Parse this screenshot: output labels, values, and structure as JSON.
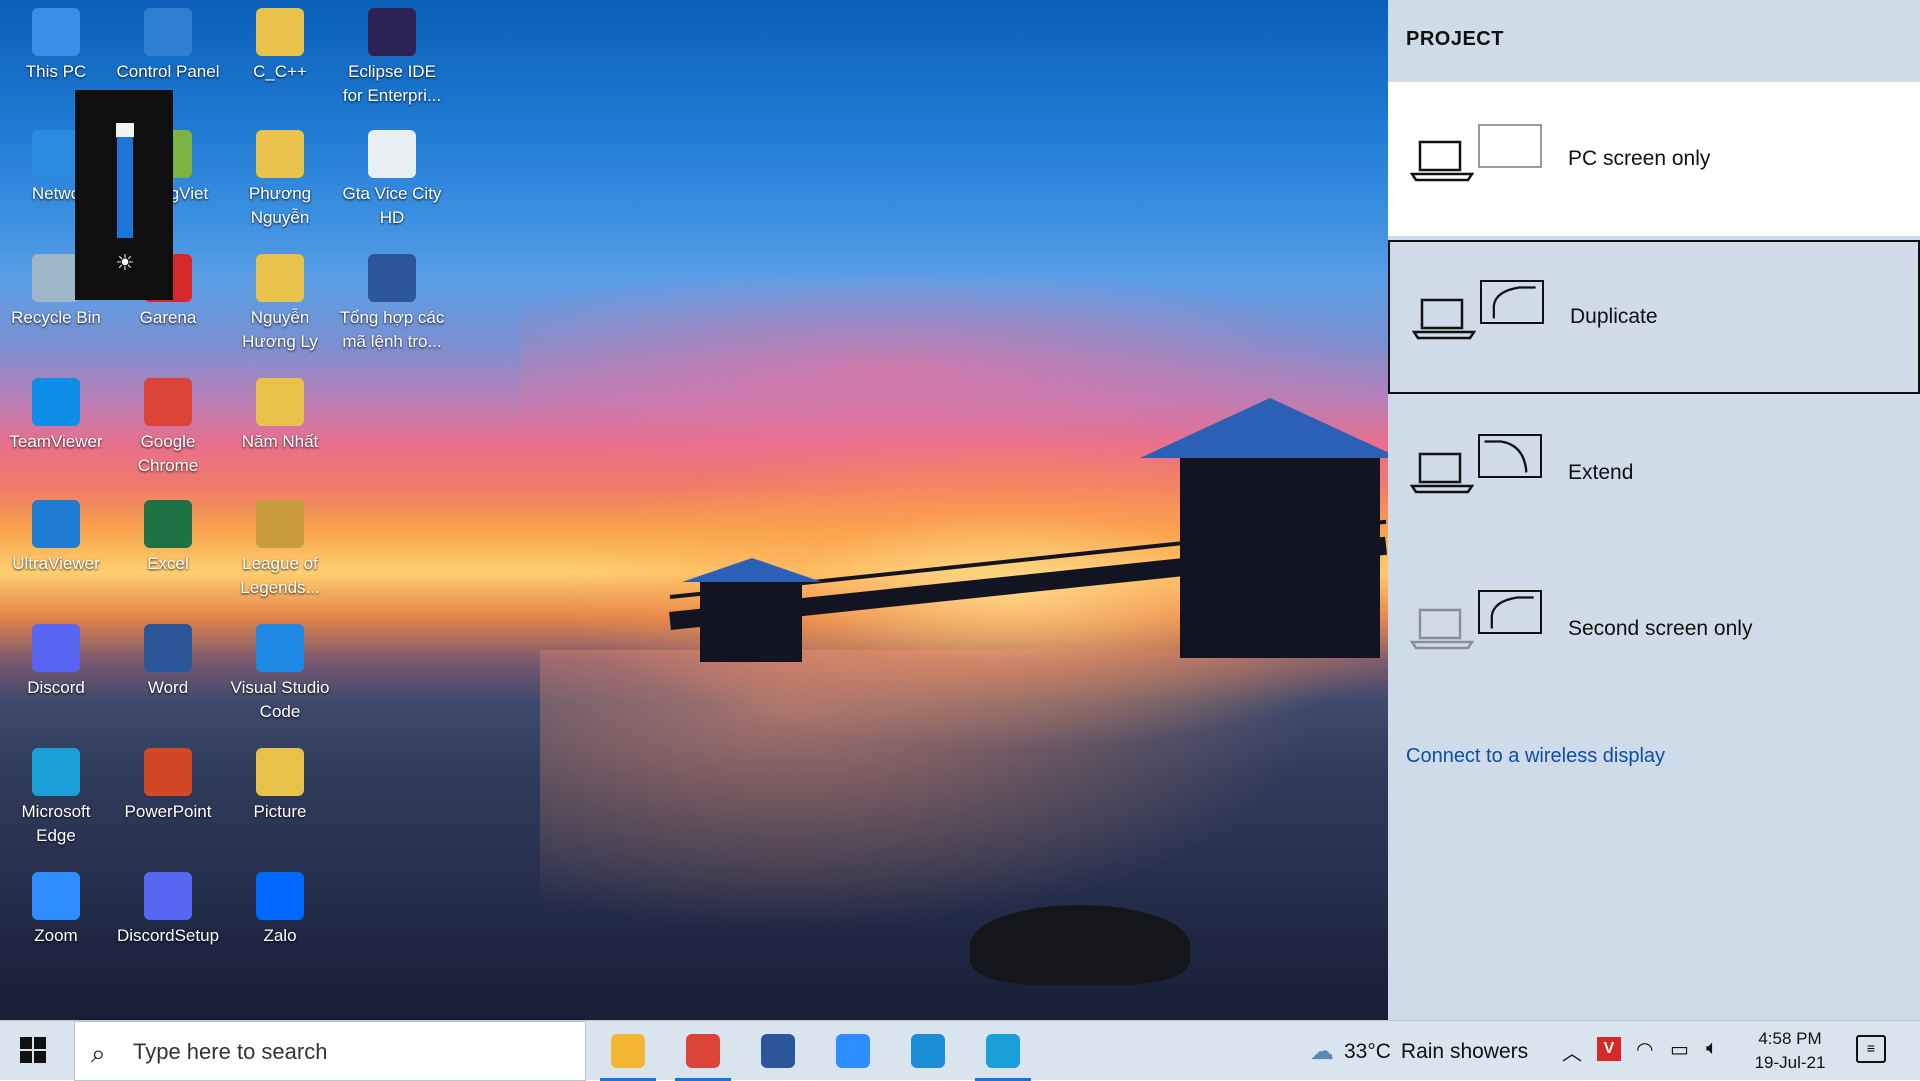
{
  "desktop": {
    "icons": [
      {
        "label": "This PC",
        "icon": "this-pc-icon",
        "color": "#3a8ee6"
      },
      {
        "label": "Control Panel",
        "icon": "control-panel-icon",
        "color": "#2f7fd0"
      },
      {
        "label": "C_C++",
        "icon": "folder-icon",
        "color": "#e8c24a"
      },
      {
        "label": "Eclipse IDE for Enterpri...",
        "icon": "eclipse-icon",
        "color": "#2c2255"
      },
      {
        "label": "Netwo",
        "icon": "network-icon",
        "color": "#2a8be0"
      },
      {
        "label": "oTiengViet",
        "icon": "unikey-icon",
        "color": "#7cb342"
      },
      {
        "label": "Phương Nguyễn",
        "icon": "user-folder-icon",
        "color": "#e8c24a"
      },
      {
        "label": "Gta Vice City HD",
        "icon": "file-icon",
        "color": "#e9eef3"
      },
      {
        "label": "Recycle Bin",
        "icon": "recycle-bin-icon",
        "color": "#9fb6c8"
      },
      {
        "label": "Garena",
        "icon": "garena-icon",
        "color": "#d62828"
      },
      {
        "label": "Nguyễn Hương Ly",
        "icon": "folder-icon",
        "color": "#e8c24a"
      },
      {
        "label": "Tổng hợp các mã lệnh tro...",
        "icon": "word-doc-icon",
        "color": "#2b579a"
      },
      {
        "label": "TeamViewer",
        "icon": "teamviewer-icon",
        "color": "#0e8ee9"
      },
      {
        "label": "Google Chrome",
        "icon": "chrome-icon",
        "color": "#db4437"
      },
      {
        "label": "Năm Nhất",
        "icon": "folder-icon",
        "color": "#e8c24a"
      },
      {
        "label": "UltraViewer",
        "icon": "ultraviewer-icon",
        "color": "#1f7ad1"
      },
      {
        "label": "Excel",
        "icon": "excel-icon",
        "color": "#1f7244"
      },
      {
        "label": "League of Legends...",
        "icon": "league-icon",
        "color": "#c89b3c"
      },
      {
        "label": "Discord",
        "icon": "discord-icon",
        "color": "#5865f2"
      },
      {
        "label": "Word",
        "icon": "word-icon",
        "color": "#2b579a"
      },
      {
        "label": "Visual Studio Code",
        "icon": "vscode-icon",
        "color": "#1e88e5"
      },
      {
        "label": "Microsoft Edge",
        "icon": "edge-icon",
        "color": "#1a9fd8"
      },
      {
        "label": "PowerPoint",
        "icon": "powerpoint-icon",
        "color": "#d24726"
      },
      {
        "label": "Picture",
        "icon": "folder-icon",
        "color": "#e8c24a"
      },
      {
        "label": "Zoom",
        "icon": "zoom-icon",
        "color": "#2d8cff"
      },
      {
        "label": "DiscordSetup",
        "icon": "discord-setup-icon",
        "color": "#5865f2"
      },
      {
        "label": "Zalo",
        "icon": "zalo-icon",
        "color": "#0068ff"
      }
    ]
  },
  "brightness": {
    "level_fraction": 0.92,
    "icon": "sun-icon"
  },
  "project_panel": {
    "title": "PROJECT",
    "options": [
      {
        "label": "PC screen only",
        "state": "hover"
      },
      {
        "label": "Duplicate",
        "state": "selected"
      },
      {
        "label": "Extend",
        "state": "normal"
      },
      {
        "label": "Second screen only",
        "state": "normal"
      }
    ],
    "wireless_link": "Connect to a wireless display"
  },
  "taskbar": {
    "search_placeholder": "Type here to search",
    "apps": [
      {
        "name": "File Explorer",
        "icon": "file-explorer-icon",
        "color": "#f2b632",
        "active": true
      },
      {
        "name": "Google Chrome",
        "icon": "chrome-icon",
        "color": "#db4437",
        "active": true
      },
      {
        "name": "Word",
        "icon": "word-icon",
        "color": "#2b579a",
        "active": false
      },
      {
        "name": "Zoom",
        "icon": "zoom-icon",
        "color": "#2d8cff",
        "active": false
      },
      {
        "name": "App",
        "icon": "app-icon",
        "color": "#1a8fd8",
        "active": false
      },
      {
        "name": "Microsoft Edge",
        "icon": "edge-icon",
        "color": "#1a9fd8",
        "active": true
      }
    ],
    "weather": {
      "temp": "33°C",
      "condition": "Rain showers"
    },
    "clock": {
      "time": "4:58 PM",
      "date": "19-Jul-21"
    }
  }
}
